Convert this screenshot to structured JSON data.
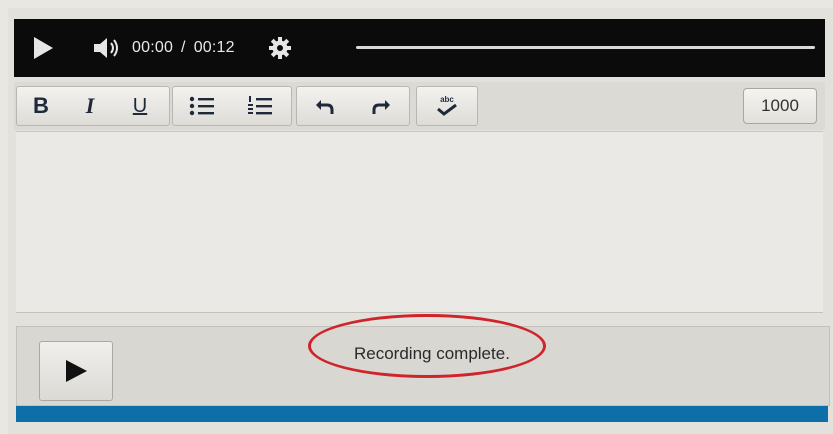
{
  "media_player": {
    "current_time": "00:00",
    "separator": "/",
    "duration": "00:12",
    "progress": 0
  },
  "toolbar": {
    "bold_label": "B",
    "italic_label": "I",
    "underline_label": "U",
    "icons": [
      "bullet-list-icon",
      "numbered-list-icon",
      "undo-icon",
      "redo-icon",
      "spellcheck-icon"
    ],
    "spellcheck_label": "abc",
    "word_limit": "1000"
  },
  "editor": {
    "value": ""
  },
  "recorder": {
    "status": "Recording complete."
  },
  "colors": {
    "media_bar": "#0b0b0c",
    "progress_bar": "#0d6fa8",
    "annotation": "#d0242a"
  }
}
